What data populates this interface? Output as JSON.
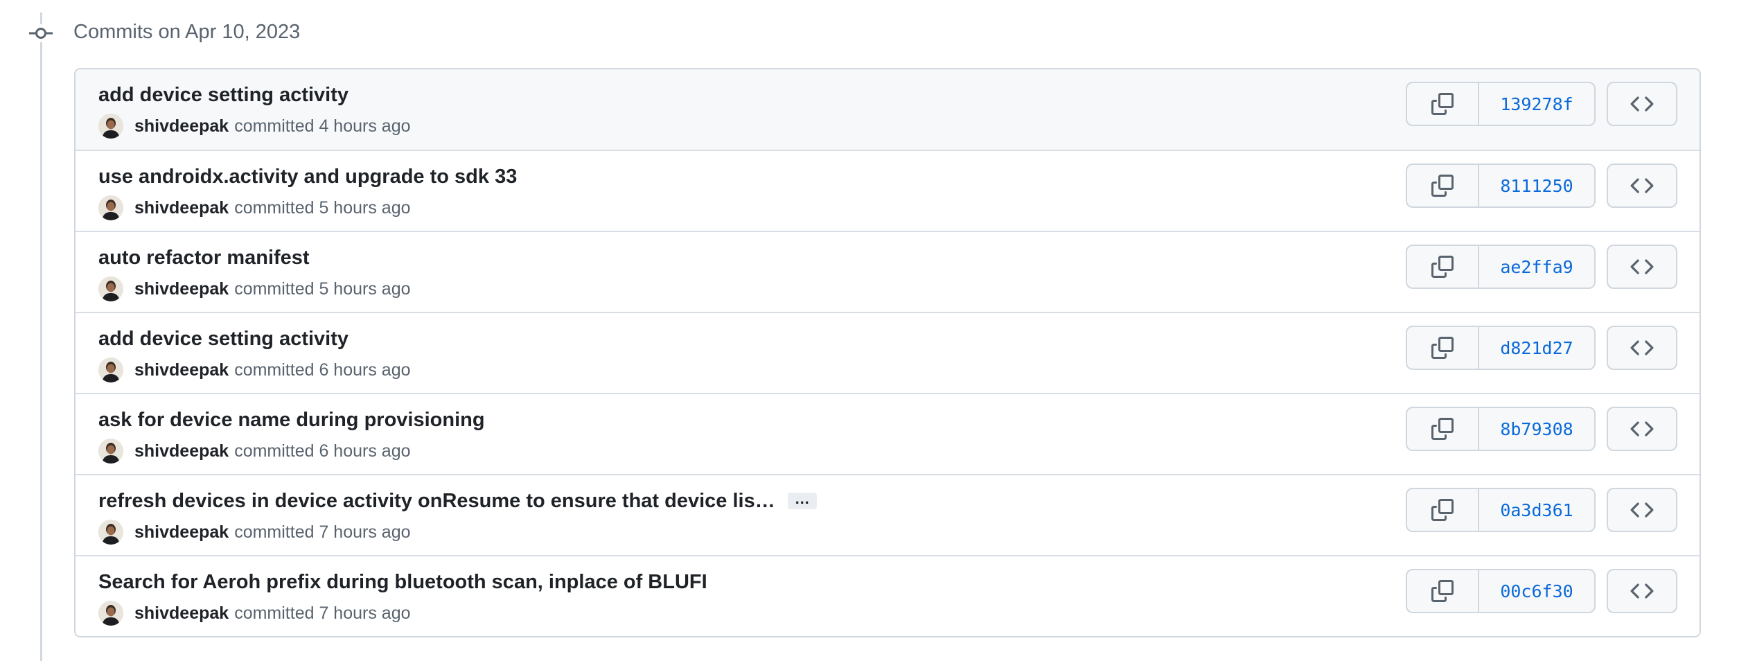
{
  "group": {
    "heading": "Commits on Apr 10, 2023"
  },
  "commits": [
    {
      "title": "add device setting activity",
      "author": "shivdeepak",
      "action": "committed",
      "time": "4 hours ago",
      "sha": "139278f"
    },
    {
      "title": "use androidx.activity and upgrade to sdk 33",
      "author": "shivdeepak",
      "action": "committed",
      "time": "5 hours ago",
      "sha": "8111250"
    },
    {
      "title": "auto refactor manifest",
      "author": "shivdeepak",
      "action": "committed",
      "time": "5 hours ago",
      "sha": "ae2ffa9"
    },
    {
      "title": "add device setting activity",
      "author": "shivdeepak",
      "action": "committed",
      "time": "6 hours ago",
      "sha": "d821d27"
    },
    {
      "title": "ask for device name during provisioning",
      "author": "shivdeepak",
      "action": "committed",
      "time": "6 hours ago",
      "sha": "8b79308"
    },
    {
      "title": "refresh devices in device activity onResume to ensure that device lis…",
      "author": "shivdeepak",
      "action": "committed",
      "time": "7 hours ago",
      "sha": "0a3d361",
      "ellipsis": "…"
    },
    {
      "title": "Search for Aeroh prefix during bluetooth scan, inplace of BLUFI",
      "author": "shivdeepak",
      "action": "committed",
      "time": "7 hours ago",
      "sha": "00c6f30"
    }
  ],
  "icons": {
    "timeline": "git-commit-icon",
    "copy": "copy-icon",
    "browse": "code-icon"
  },
  "colors": {
    "sha_link": "#0969da",
    "border": "#d0d7de",
    "muted_text": "#59636e"
  }
}
